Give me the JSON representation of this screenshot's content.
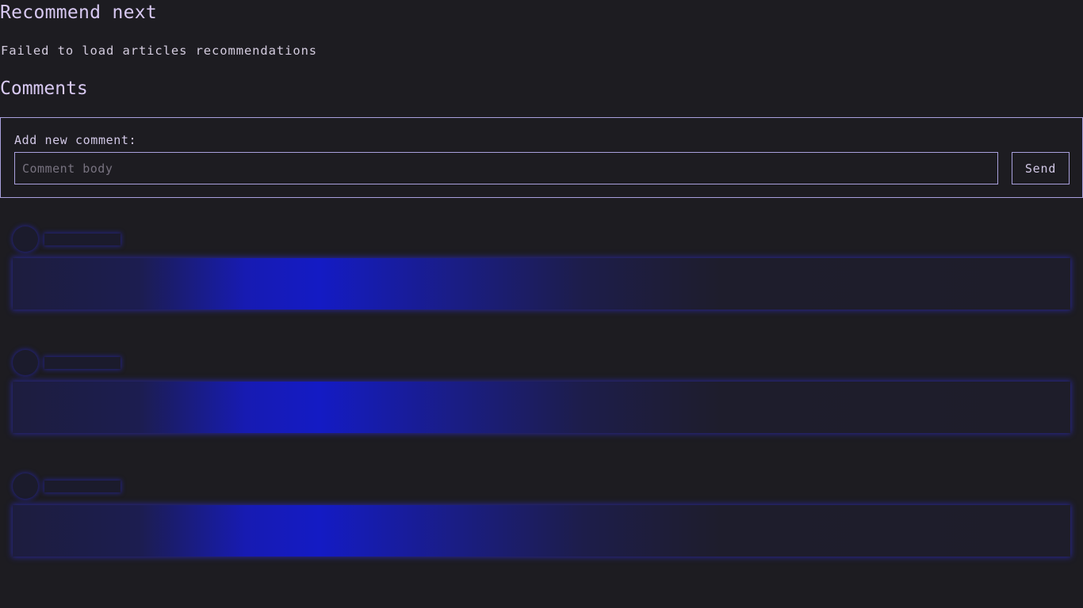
{
  "recommend": {
    "title": "Recommend next",
    "error": "Failed to load articles recommendations"
  },
  "comments": {
    "title": "Comments",
    "form": {
      "label": "Add new comment:",
      "input_value": "",
      "input_placeholder": "Comment body",
      "send_label": "Send"
    },
    "loading_placeholders": 3
  },
  "colors": {
    "background": "#1d1c21",
    "accent_border": "#a9a0dd",
    "heading": "#d8c9f2",
    "skeleton_glow": "#141bc4"
  }
}
